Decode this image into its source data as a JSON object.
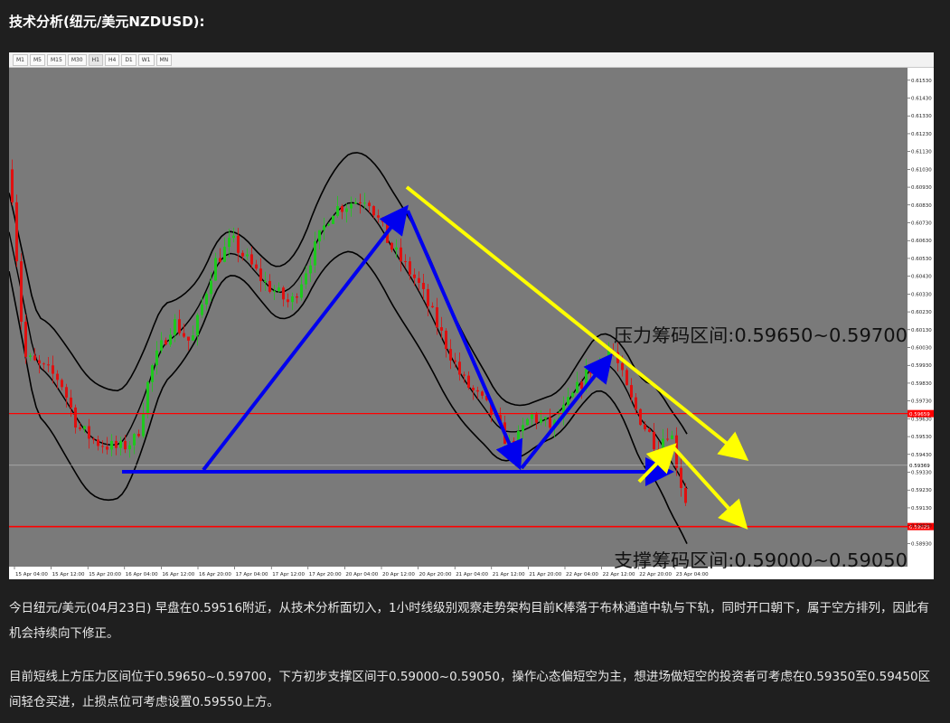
{
  "heading": "技术分析(纽元/美元NZDUSD):",
  "toolbar": {
    "timeframes": [
      "M1",
      "M5",
      "M15",
      "M30",
      "H1",
      "H4",
      "D1",
      "W1",
      "MN"
    ],
    "active": "H1"
  },
  "chart_data": {
    "type": "candlestick",
    "instrument": "NZDUSD",
    "timeframe": "H1",
    "price_range": [
      0.588,
      0.616
    ],
    "price_ticks": [
      "0.61530",
      "0.61430",
      "0.61330",
      "0.61230",
      "0.61130",
      "0.61030",
      "0.60930",
      "0.60830",
      "0.60730",
      "0.60630",
      "0.60530",
      "0.60430",
      "0.60330",
      "0.60230",
      "0.60130",
      "0.60030",
      "0.59930",
      "0.59830",
      "0.59730",
      "0.59630",
      "0.59530",
      "0.59430",
      "0.59330",
      "0.59230",
      "0.59130",
      "0.59030",
      "0.58930"
    ],
    "time_ticks": [
      "15 Apr 04:00",
      "15 Apr 12:00",
      "15 Apr 20:00",
      "16 Apr 04:00",
      "16 Apr 12:00",
      "16 Apr 20:00",
      "17 Apr 04:00",
      "17 Apr 12:00",
      "17 Apr 20:00",
      "20 Apr 04:00",
      "20 Apr 12:00",
      "20 Apr 20:00",
      "21 Apr 04:00",
      "21 Apr 12:00",
      "21 Apr 20:00",
      "22 Apr 04:00",
      "22 Apr 12:00",
      "22 Apr 20:00",
      "23 Apr 04:00"
    ],
    "price_labels": {
      "resistance_line": "0.59659",
      "current": "0.59369",
      "support_line": "0.59025"
    },
    "resistance_zone": {
      "label": "压力筹码区间:0.59650~0.59700",
      "price": 0.59659
    },
    "support_zone": {
      "label": "支撑筹码区间:0.59000~0.59050",
      "price": 0.59025
    },
    "current_price": 0.59369,
    "indicator": "Bollinger Bands",
    "colors": {
      "background": "#7a7a7a",
      "bull_candle": "#1ec81e",
      "bear_candle": "#e01010",
      "bands": "#000000",
      "levels": "#ff0000",
      "wave_arrows": "#0000ee",
      "projection_arrows": "#ffff00"
    }
  },
  "paragraphs": [
    "今日纽元/美元(04月23日) 早盘在0.59516附近，从技术分析面切入，1小时线级别观察走势架构目前K棒落于布林通道中轨与下轨，同时开口朝下，属于空方排列，因此有机会持续向下修正。",
    "目前短线上方压力区间位于0.59650~0.59700，下方初步支撑区间于0.59000~0.59050，操作心态偏短空为主，想进场做短空的投资者可考虑在0.59350至0.59450区间轻仓买进，止损点位可考虑设置0.59550上方。"
  ]
}
